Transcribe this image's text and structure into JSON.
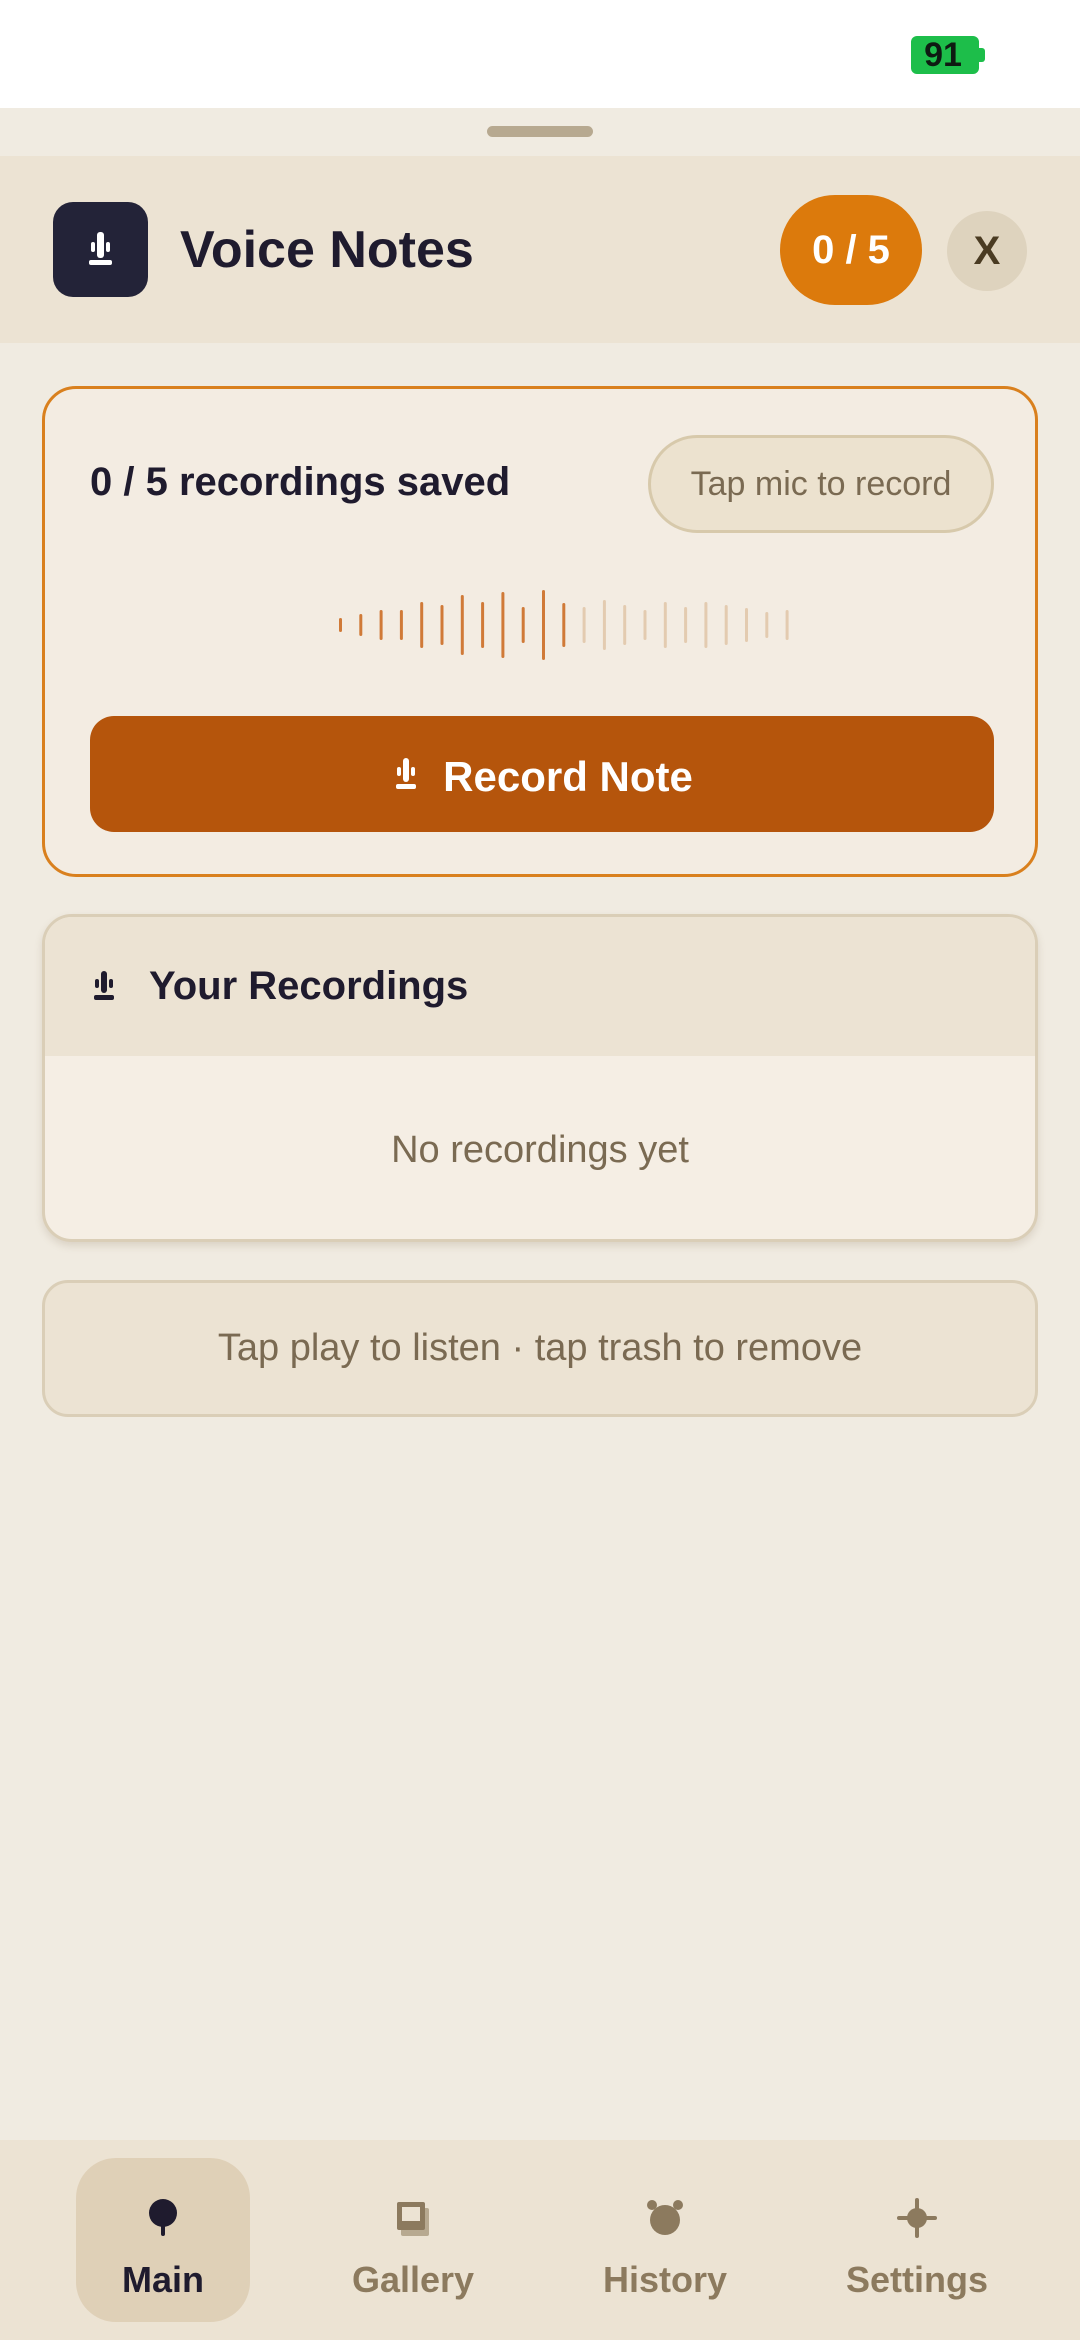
{
  "status_bar": {
    "battery": "91"
  },
  "header": {
    "title": "Voice Notes",
    "count_badge": "0 / 5",
    "close_label": "X"
  },
  "record_card": {
    "saved_text": "0 / 5 recordings saved",
    "hint": "Tap mic to record",
    "record_button_label": "Record Note"
  },
  "recordings": {
    "title": "Your Recordings",
    "empty_text": "No recordings yet"
  },
  "tip": "Tap play to listen · tap trash to remove",
  "nav": {
    "items": [
      {
        "label": "Main",
        "icon": "pin-icon",
        "active": true
      },
      {
        "label": "Gallery",
        "icon": "gallery-icon",
        "active": false
      },
      {
        "label": "History",
        "icon": "clock-icon",
        "active": false
      },
      {
        "label": "Settings",
        "icon": "gear-icon",
        "active": false
      }
    ]
  },
  "colors": {
    "accent": "#DC7A0C",
    "record_button": "#B5550C",
    "background": "#F0EBE1",
    "header_bg": "#ECE3D3",
    "dark": "#1F1B2E",
    "battery": "#1DBE4A"
  }
}
